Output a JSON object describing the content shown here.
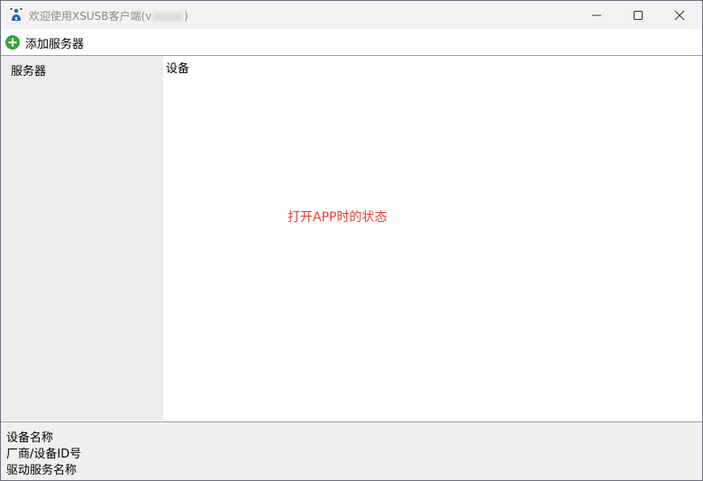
{
  "window": {
    "title_prefix": "欢迎使用XSUSB客户端(v",
    "title_suffix": ")"
  },
  "toolbar": {
    "add_server_label": "添加服务器"
  },
  "sidebar": {
    "header": "服务器"
  },
  "main": {
    "devices_header": "设备",
    "annotation": "打开APP时的状态"
  },
  "details": {
    "device_name_label": "设备名称",
    "vendor_device_id_label": "厂商/设备ID号",
    "driver_service_name_label": "驱动服务名称"
  },
  "colors": {
    "accent_green": "#3aa63a",
    "annotation_red": "#e8403a",
    "titlebar_bg": "#f3f3f3",
    "sidebar_bg": "#ececec"
  },
  "icons": {
    "app": "usb-person-icon",
    "add": "plus-circle-icon",
    "minimize": "minimize-icon",
    "maximize": "maximize-icon",
    "close": "close-icon"
  }
}
